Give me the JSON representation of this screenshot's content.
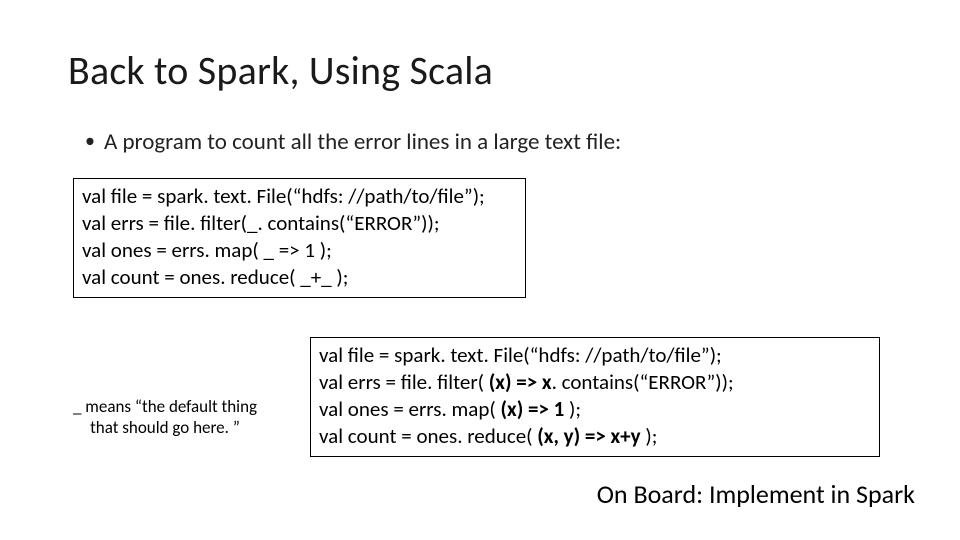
{
  "title": "Back to Spark, Using Scala",
  "bullet": "A program to count all the error lines in a large text file:",
  "code1": {
    "l1": "val file = spark. text. File(“hdfs: //path/to/file”);",
    "l2": "val errs = file. filter(_. contains(“ERROR”));",
    "l3": "val ones = errs. map( _ => 1 );",
    "l4": "val count = ones. reduce( _+_ );"
  },
  "code2": {
    "l1_a": "val file = spark. text. File(“hdfs: //path/to/file”);",
    "l2_a": "val errs = file. filter( ",
    "l2_b": "(x) => x",
    "l2_c": ". contains(“ERROR”));",
    "l3_a": "val ones = errs. map( ",
    "l3_b": "(x) => 1",
    "l3_c": " );",
    "l4_a": "val count = ones. reduce( ",
    "l4_b": "(x, y) => x+y",
    "l4_c": " );"
  },
  "note_line1": "_ means “the default thing",
  "note_line2": "that should go here. ”",
  "footer": "On Board: Implement in Spark"
}
